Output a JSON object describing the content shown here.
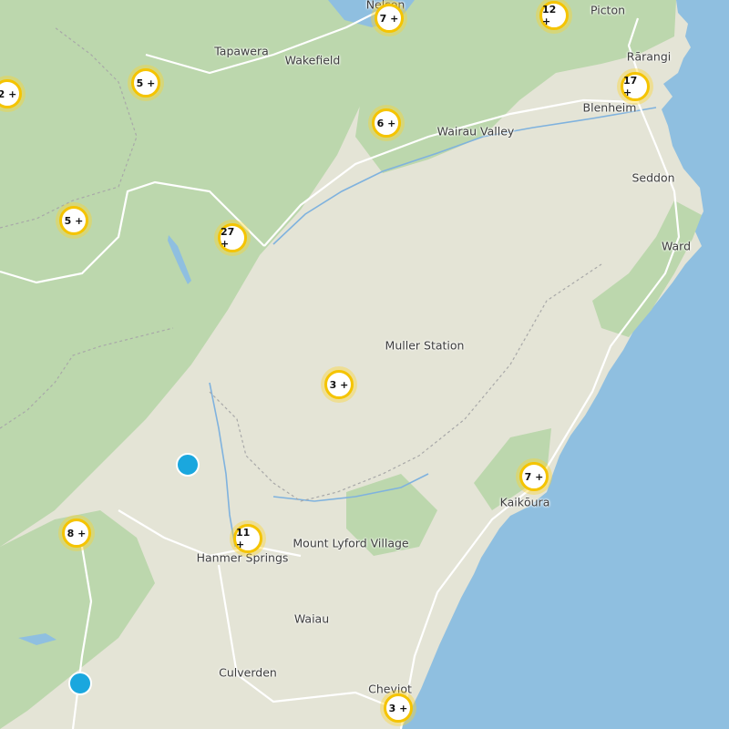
{
  "map": {
    "colors": {
      "sea": "#8fbfe0",
      "land": "#e4e4d6",
      "forest": "#bcd7ad",
      "lake": "#8fbfe0",
      "river": "#7fb2de",
      "road": "#ffffff",
      "border": "#a8a8a8",
      "cluster_ring": "#f5c400",
      "marker": "#1aa7de"
    },
    "places": [
      "Picton",
      "Tapawera",
      "Wakefield",
      "Rārangi",
      "Blenheim",
      "Wairau Valley",
      "Seddon",
      "Ward",
      "Muller Station",
      "Kaikōura",
      "Mount Lyford Village",
      "Hanmer Springs",
      "Waiau",
      "Culverden",
      "Cheviot",
      "Nelson"
    ],
    "clusters": [
      {
        "label": "7 +"
      },
      {
        "label": "12 +"
      },
      {
        "label": "2 +"
      },
      {
        "label": "5 +"
      },
      {
        "label": "17 +"
      },
      {
        "label": "6 +"
      },
      {
        "label": "5 +"
      },
      {
        "label": "27 +"
      },
      {
        "label": "3 +"
      },
      {
        "label": "7 +"
      },
      {
        "label": "8 +"
      },
      {
        "label": "11 +"
      },
      {
        "label": "3 +"
      }
    ],
    "markers": [
      "single-marker",
      "single-marker"
    ]
  }
}
